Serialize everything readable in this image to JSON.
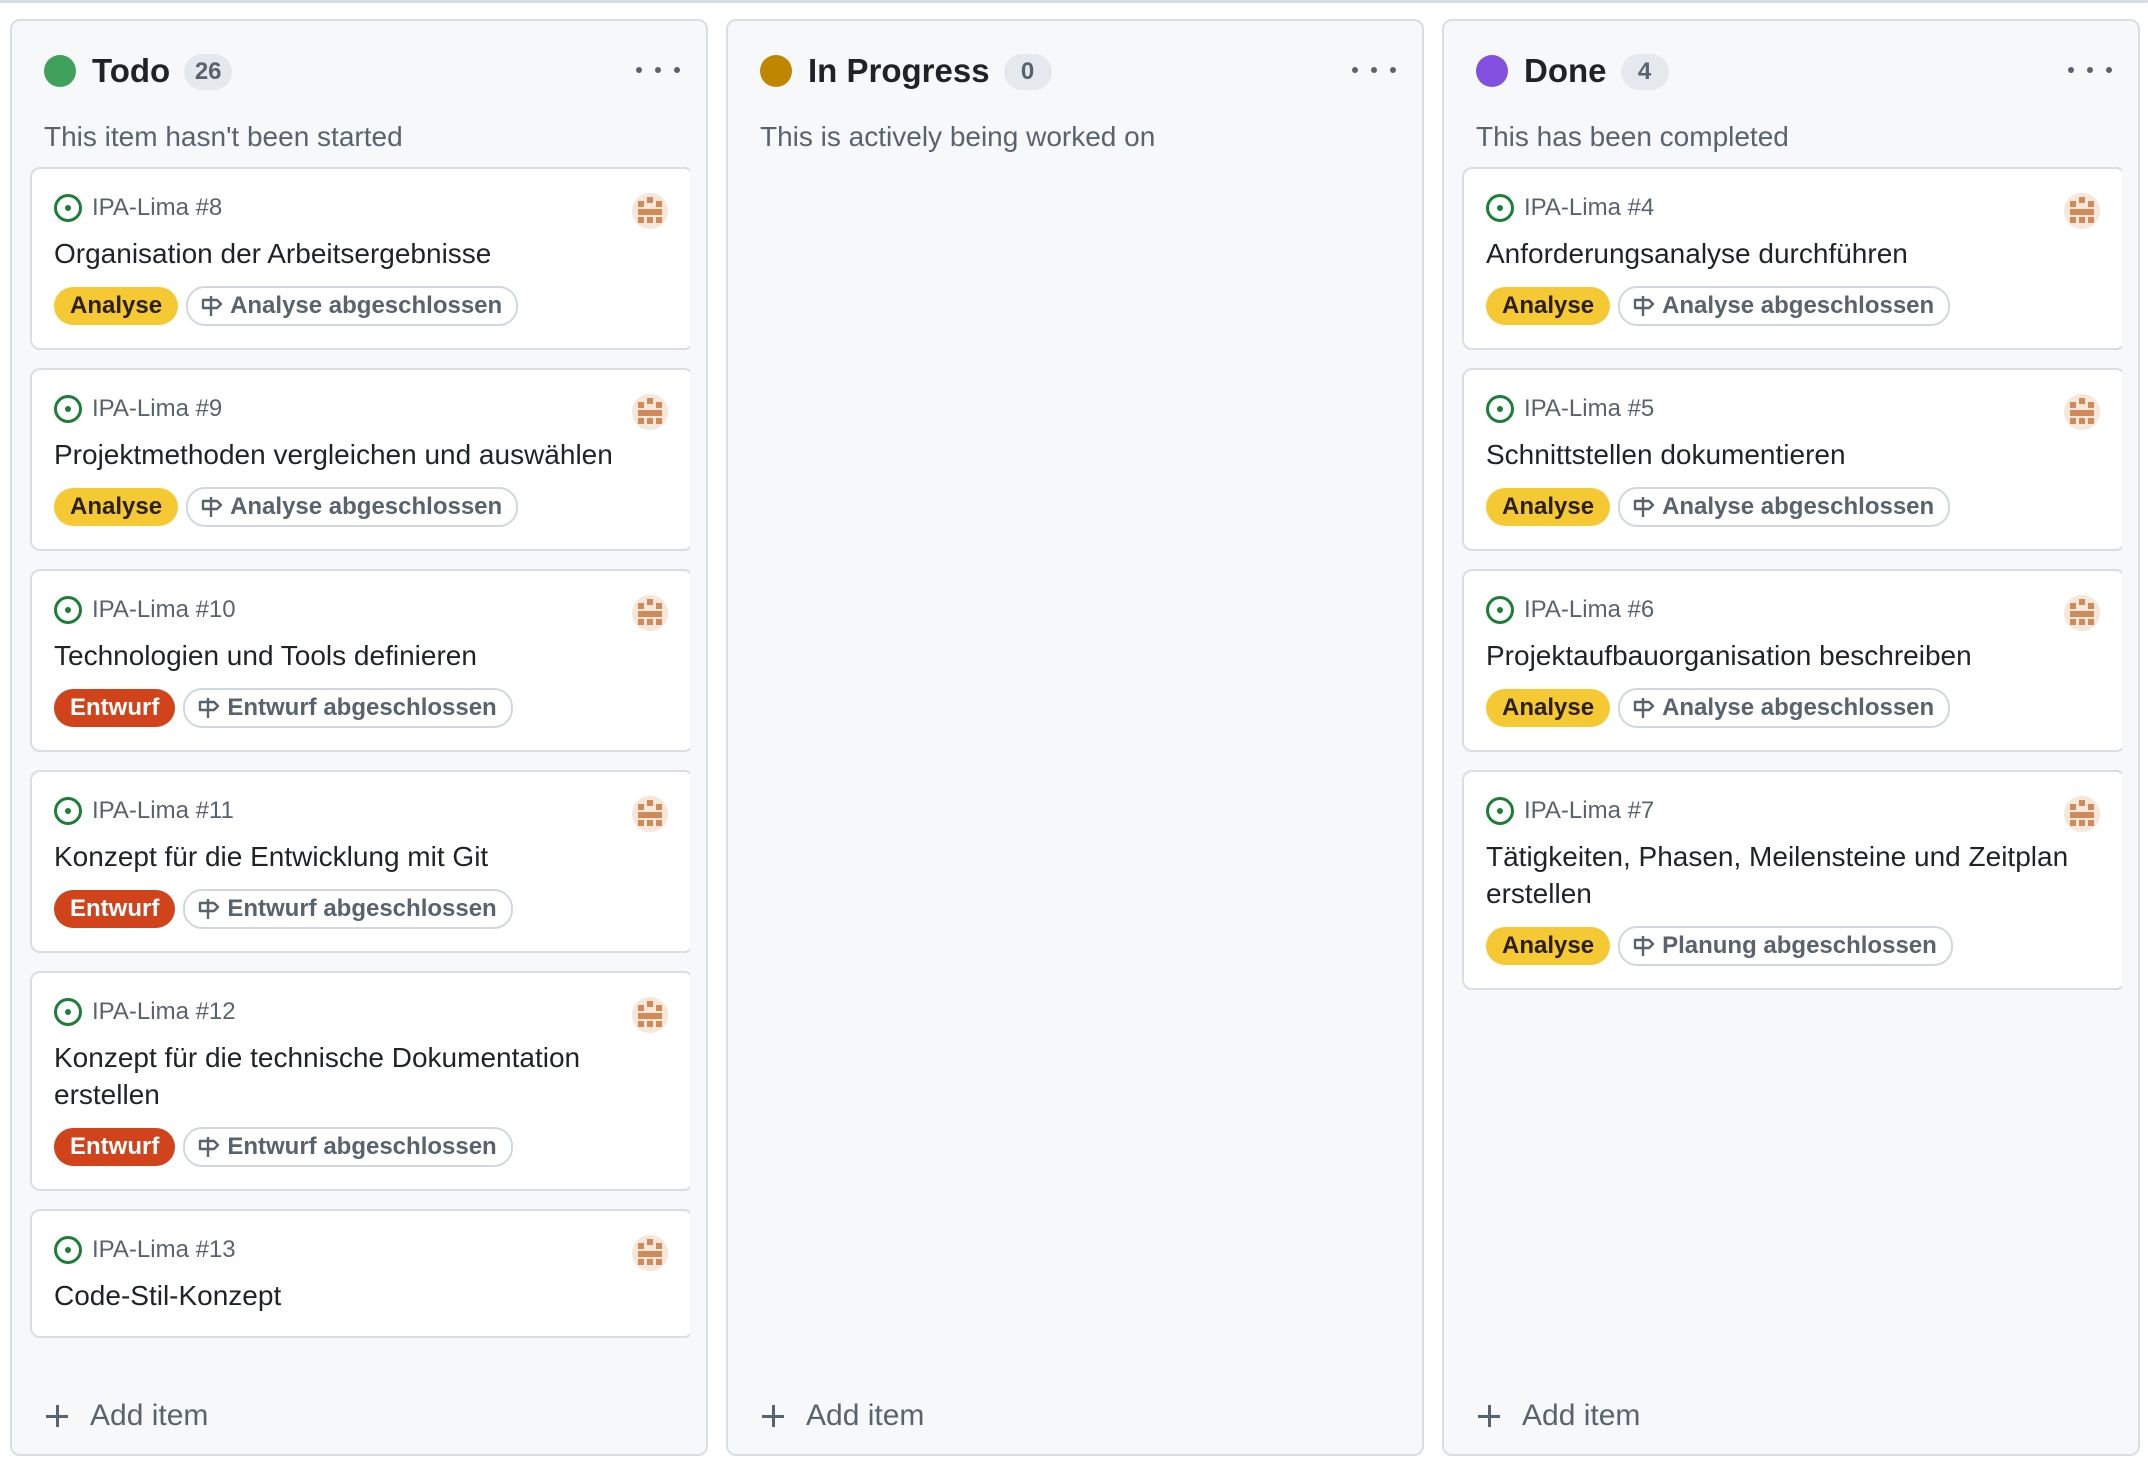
{
  "columns": [
    {
      "title": "Todo",
      "count": "26",
      "dot_color": "#3fa15b",
      "description": "This item hasn't been started",
      "add_label": "Add item",
      "cards": [
        {
          "ref": "IPA-Lima #8",
          "title": "Organisation der Arbeitsergebnisse",
          "label": "Analyse",
          "label_kind": "analyse",
          "milestone": "Analyse abgeschlossen"
        },
        {
          "ref": "IPA-Lima #9",
          "title": "Projektmethoden vergleichen und auswählen",
          "label": "Analyse",
          "label_kind": "analyse",
          "milestone": "Analyse abgeschlossen"
        },
        {
          "ref": "IPA-Lima #10",
          "title": "Technologien und Tools definieren",
          "label": "Entwurf",
          "label_kind": "entwurf",
          "milestone": "Entwurf abgeschlossen"
        },
        {
          "ref": "IPA-Lima #11",
          "title": "Konzept für die Entwicklung mit Git",
          "label": "Entwurf",
          "label_kind": "entwurf",
          "milestone": "Entwurf abgeschlossen"
        },
        {
          "ref": "IPA-Lima #12",
          "title": "Konzept für die technische Dokumentation erstellen",
          "label": "Entwurf",
          "label_kind": "entwurf",
          "milestone": "Entwurf abgeschlossen"
        },
        {
          "ref": "IPA-Lima #13",
          "title": "Code-Stil-Konzept",
          "label": "",
          "label_kind": "entwurf",
          "milestone": ""
        }
      ]
    },
    {
      "title": "In Progress",
      "count": "0",
      "dot_color": "#bf8700",
      "description": "This is actively being worked on",
      "add_label": "Add item",
      "cards": []
    },
    {
      "title": "Done",
      "count": "4",
      "dot_color": "#8250df",
      "description": "This has been completed",
      "add_label": "Add item",
      "cards": [
        {
          "ref": "IPA-Lima #4",
          "title": "Anforderungsanalyse durchführen",
          "label": "Analyse",
          "label_kind": "analyse",
          "milestone": "Analyse abgeschlossen"
        },
        {
          "ref": "IPA-Lima #5",
          "title": "Schnittstellen dokumentieren",
          "label": "Analyse",
          "label_kind": "analyse",
          "milestone": "Analyse abgeschlossen"
        },
        {
          "ref": "IPA-Lima #6",
          "title": "Projektaufbauorganisation beschreiben",
          "label": "Analyse",
          "label_kind": "analyse",
          "milestone": "Analyse abgeschlossen"
        },
        {
          "ref": "IPA-Lima #7",
          "title": "Tätigkeiten, Phasen, Meilensteine und Zeitplan erstellen",
          "label": "Analyse",
          "label_kind": "analyse",
          "milestone": "Planung abgeschlossen"
        }
      ]
    }
  ]
}
